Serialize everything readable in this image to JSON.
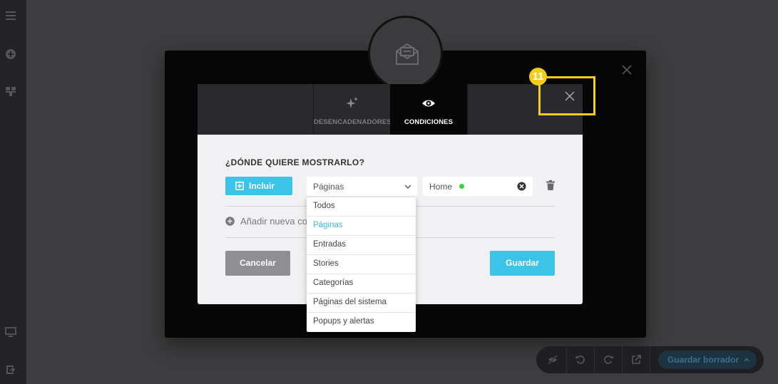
{
  "modal": {
    "tabs": [
      {
        "label": "DESENCADENADORES",
        "icon": "sparkles-icon"
      },
      {
        "label": "CONDICIONES",
        "icon": "eye-icon"
      }
    ],
    "heading": "¿DÓNDE QUIERE MOSTRARLO?",
    "include_label": "Incluir",
    "select_value": "Páginas",
    "tag_value": "Home",
    "add_condition_label": "Añadir nueva co",
    "cancel_label": "Cancelar",
    "save_label": "Guardar"
  },
  "dropdown": {
    "options": [
      "Todos",
      "Páginas",
      "Entradas",
      "Stories",
      "Categorías",
      "Páginas del sistema",
      "Popups y alertas"
    ],
    "selected": "Páginas"
  },
  "annotation": {
    "badge": "11",
    "color": "#f2cd1c"
  },
  "toolbar": {
    "save_draft_label": "Guardar borrador"
  },
  "colors": {
    "accent": "#3cc3e8",
    "status_dot": "#3ad33a"
  }
}
